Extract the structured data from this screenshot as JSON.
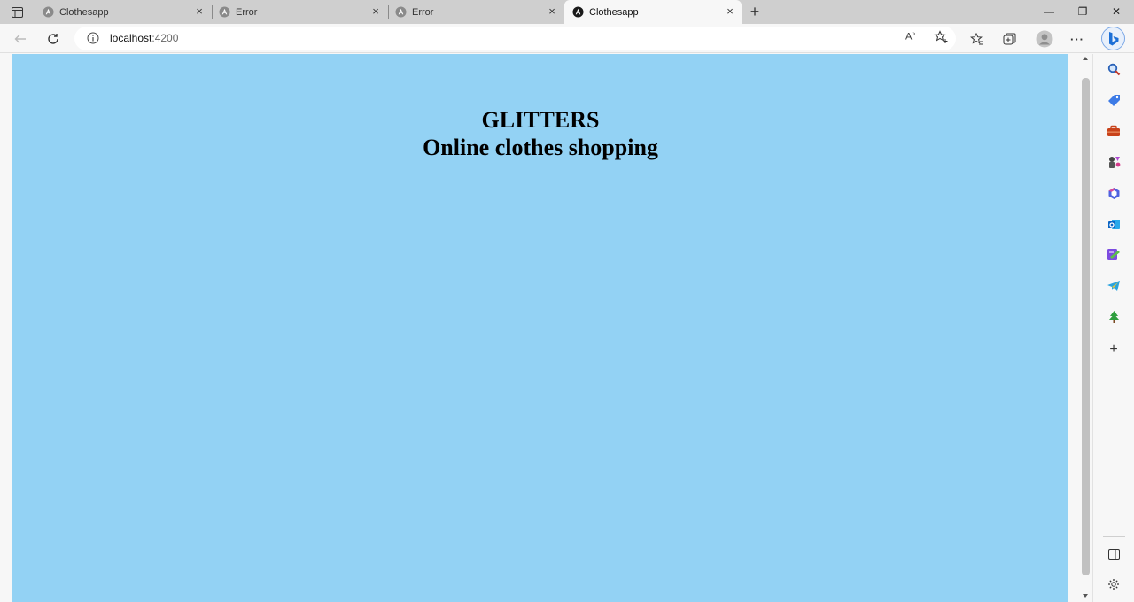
{
  "browser": {
    "tabs": [
      {
        "title": "Clothesapp",
        "active": false
      },
      {
        "title": "Error",
        "active": false
      },
      {
        "title": "Error",
        "active": false
      },
      {
        "title": "Clothesapp",
        "active": true
      }
    ],
    "close_glyph": "×",
    "new_tab_glyph": "+",
    "address": {
      "host": "localhost",
      "port": ":4200"
    },
    "window_controls": {
      "minimize": "—",
      "maximize": "❐",
      "close": "✕"
    },
    "more_glyph": "···"
  },
  "page": {
    "background_color": "#93d2f4",
    "title": "GLITTERS",
    "subtitle": "Online clothes shopping"
  },
  "sidebar": {
    "items": [
      "search-icon",
      "shopping-tag-icon",
      "tools-icon",
      "games-icon",
      "office-icon",
      "outlook-icon",
      "drop-icon",
      "telegram-icon",
      "tree-icon",
      "add-icon"
    ],
    "bottom": [
      "split-screen-icon",
      "settings-icon"
    ]
  }
}
